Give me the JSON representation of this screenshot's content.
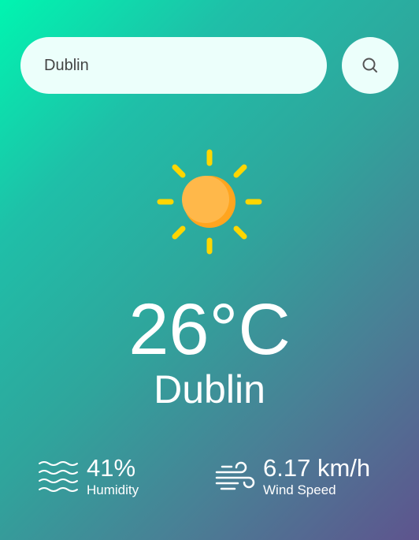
{
  "search": {
    "value": "Dublin",
    "placeholder": ""
  },
  "search_button": {
    "icon": "search-icon"
  },
  "weather": {
    "icon": "sun-icon",
    "temperature": "26°C",
    "city": "Dublin"
  },
  "details": {
    "humidity": {
      "icon": "humidity-waves-icon",
      "value": "41%",
      "label": "Humidity"
    },
    "wind": {
      "icon": "wind-icon",
      "value": "6.17 km/h",
      "label": "Wind Speed"
    }
  },
  "colors": {
    "gradient_start": "#00f5b0",
    "gradient_end": "#5e548e",
    "input_background": "#ecfffb",
    "sun_core": "#ffb13b",
    "sun_rays": "#ffd600"
  }
}
